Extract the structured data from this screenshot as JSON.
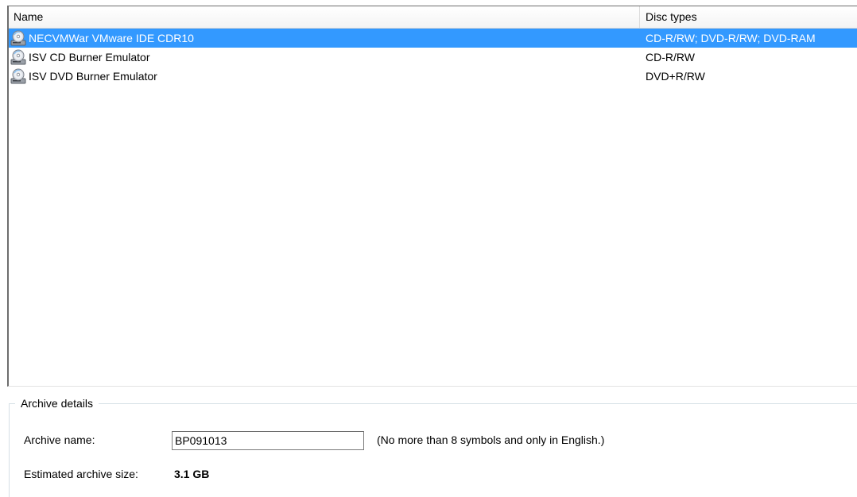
{
  "list": {
    "columns": {
      "name": "Name",
      "disc_types": "Disc types"
    },
    "rows": [
      {
        "name": "NECVMWar VMware IDE CDR10",
        "disc_types": "CD-R/RW; DVD-R/RW; DVD-RAM",
        "selected": true,
        "icon": "cd-drive-icon"
      },
      {
        "name": "ISV CD Burner Emulator",
        "disc_types": "CD-R/RW",
        "selected": false,
        "icon": "cd-drive-icon"
      },
      {
        "name": "ISV DVD Burner Emulator",
        "disc_types": "DVD+R/RW",
        "selected": false,
        "icon": "cd-drive-icon"
      }
    ]
  },
  "archive_details": {
    "title": "Archive details",
    "name_label": "Archive name:",
    "name_value": "BP091013",
    "name_hint": "(No more than 8 symbols and only in English.)",
    "size_label": "Estimated archive size:",
    "size_value": "3.1 GB"
  },
  "colors": {
    "selection": "#3399ff",
    "selection_text": "#ffffff"
  }
}
